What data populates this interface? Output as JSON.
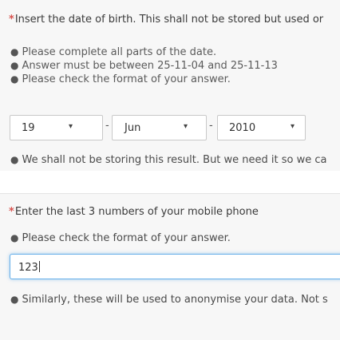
{
  "dob_question": {
    "required_mark": "*",
    "text": "Insert the date of birth. This shall not be stored but used or",
    "hints": [
      {
        "icon": "info-circle-icon",
        "text": "Please complete all parts of the date."
      },
      {
        "icon": "info-circle-icon",
        "text": "Answer must be between 25-11-04 and 25-11-13"
      },
      {
        "icon": "info-circle-icon",
        "text": "Please check the format of your answer."
      }
    ],
    "day": "19",
    "month": "Jun",
    "year": "2010",
    "separator": "-",
    "chevron": "▾",
    "help": "We shall not be storing this result. But we need it so we ca"
  },
  "phone_question": {
    "required_mark": "*",
    "text": "Enter the last 3 numbers of your mobile phone",
    "hint": "Please check the format of your answer.",
    "value": "123",
    "help": "Similarly, these will be used to anonymise your data. Not s"
  },
  "colors": {
    "required": "#d9534f",
    "focus_border": "#66afe9",
    "panel_bg": "#f7f7f7"
  }
}
